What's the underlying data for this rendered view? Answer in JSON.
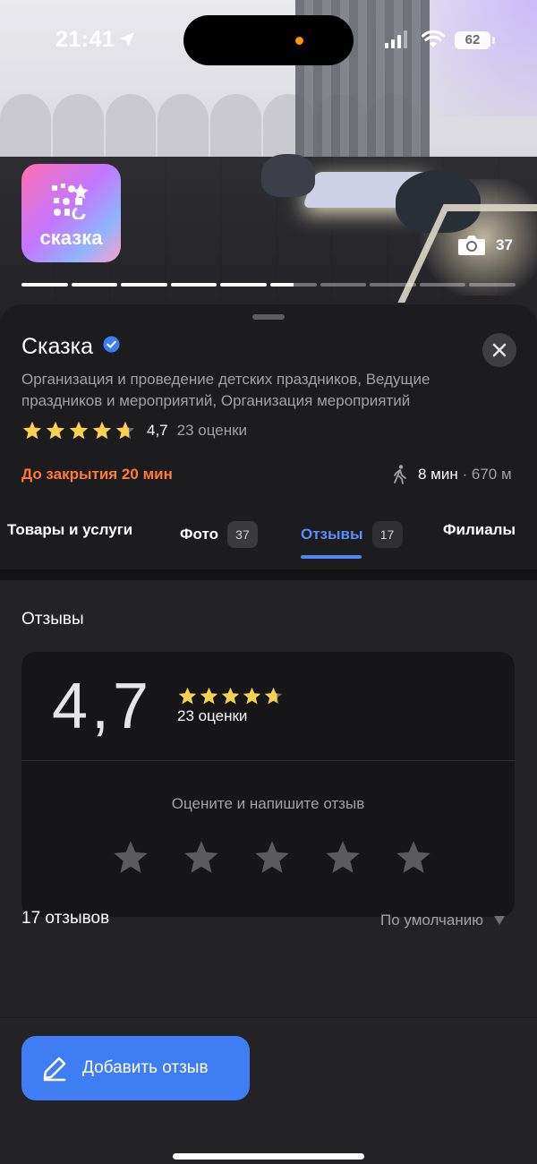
{
  "status_bar": {
    "time": "21:41",
    "battery": "62"
  },
  "hero": {
    "logo_text": "сказка",
    "photo_count": "37",
    "gallery_total": 10,
    "gallery_current": 6
  },
  "org": {
    "name": "Сказка",
    "categories": "Организация и проведение детских праздников, Ведущие праздников и мероприятий, Организация мероприятий",
    "rating": "4,7",
    "rating_value": 4.7,
    "rating_count": "23 оценки",
    "closing": "До закрытия 20 мин",
    "walk_time": "8 мин",
    "distance": "· 670 м"
  },
  "tabs": [
    {
      "label": "Товары и услуги"
    },
    {
      "label": "Фото",
      "badge": "37"
    },
    {
      "label": "Отзывы",
      "badge": "17",
      "active": true
    },
    {
      "label": "Филиалы"
    }
  ],
  "reviews": {
    "heading": "Отзывы",
    "big_rating": "4,7",
    "count_label": "23 оценки",
    "rate_prompt": "Оцените и напишите отзыв",
    "total": "17 отзывов",
    "sort": "По умолчанию",
    "add_button": "Добавить отзыв"
  },
  "colors": {
    "accent": "#3f7df4",
    "active_tab": "#5b8cff",
    "closing": "#ff7a37",
    "star": "#fbd24f"
  }
}
